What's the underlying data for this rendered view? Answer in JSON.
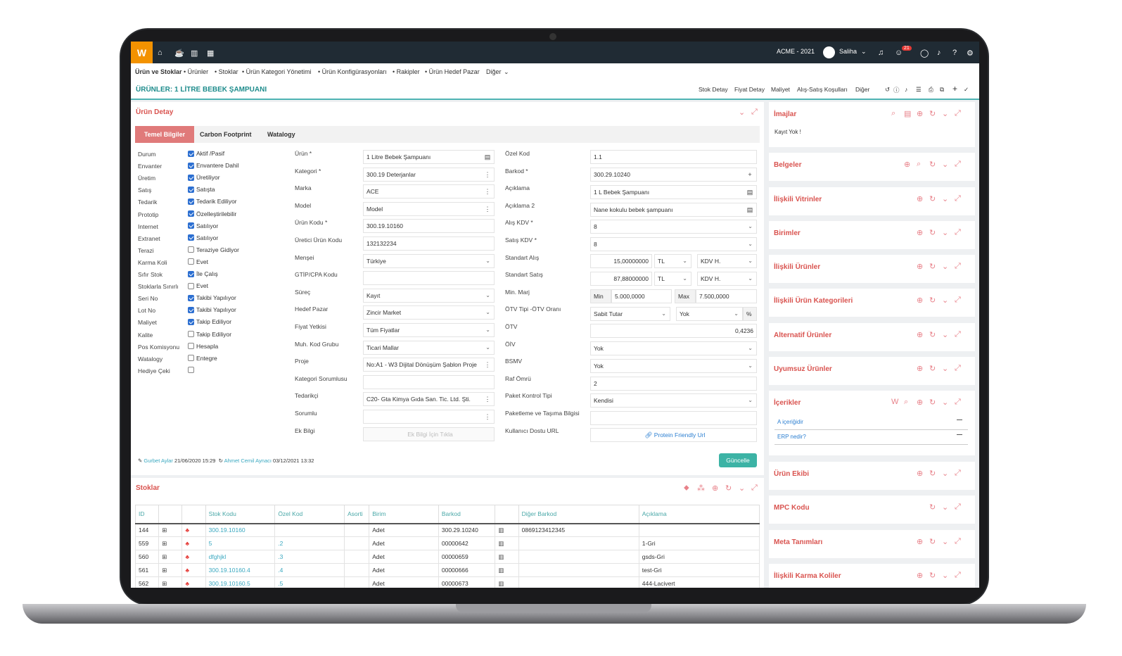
{
  "topbar": {
    "logo": "W",
    "company": "ACME - 2021",
    "user": "Saliha",
    "notif_count": "21"
  },
  "menu": [
    "Ürün ve Stoklar",
    "• Ürünler",
    "• Stoklar",
    "• Ürün Kategori Yönetimi",
    "• Ürün Konfigürasyonları",
    "• Rakipler",
    "• Ürün Hedef Pazar",
    "Diğer"
  ],
  "title": "ÜRÜNLER: 1 LİTRE BEBEK ŞAMPUANI",
  "title_links": [
    "Stok Detay",
    "Fiyat Detay",
    "Maliyet",
    "Alış-Satış Koşulları",
    "Diğer"
  ],
  "detail": {
    "heading": "Ürün Detay",
    "tabs": [
      "Temel Bilgiler",
      "Carbon Footprint",
      "Watalogy"
    ],
    "flags": [
      {
        "label": "Durum",
        "text": "Aktif /Pasif",
        "checked": true
      },
      {
        "label": "Envanter",
        "text": "Envantere Dahil",
        "checked": true
      },
      {
        "label": "Üretim",
        "text": "Üretiliyor",
        "checked": true
      },
      {
        "label": "Satış",
        "text": "Satışta",
        "checked": true
      },
      {
        "label": "Tedarik",
        "text": "Tedarik Ediliyor",
        "checked": true
      },
      {
        "label": "Prototip",
        "text": "Özelleştirilebilir",
        "checked": true
      },
      {
        "label": "Internet",
        "text": "Satılıyor",
        "checked": true
      },
      {
        "label": "Extranet",
        "text": "Satılıyor",
        "checked": true
      },
      {
        "label": "Terazi",
        "text": "Teraziye Gidiyor",
        "checked": false
      },
      {
        "label": "Karma Koli",
        "text": "Evet",
        "checked": false
      },
      {
        "label": "Sıfır Stok",
        "text": "İle Çalış",
        "checked": true
      },
      {
        "label": "Stoklarla Sınırlı",
        "text": "Evet",
        "checked": false
      },
      {
        "label": "Seri No",
        "text": "Takibi Yapılıyor",
        "checked": true
      },
      {
        "label": "Lot No",
        "text": "Takibi Yapılıyor",
        "checked": true
      },
      {
        "label": "Maliyet",
        "text": "Takip Ediliyor",
        "checked": true
      },
      {
        "label": "Kalite",
        "text": "Takip Ediliyor",
        "checked": false
      },
      {
        "label": "Pos Komisyonu",
        "text": "Hesapla",
        "checked": false
      },
      {
        "label": "Watalogy",
        "text": "Entegre",
        "checked": false
      },
      {
        "label": "Hediye Çeki",
        "text": "",
        "checked": false
      }
    ],
    "mid": [
      {
        "label": "Ürün *",
        "value": "1 Litre Bebek Şampuanı",
        "sfx": "▤"
      },
      {
        "label": "Kategori *",
        "value": "300.19 Deterjanlar",
        "sfx": "⋮"
      },
      {
        "label": "Marka",
        "value": "ACE",
        "sfx": "⋮"
      },
      {
        "label": "Model",
        "value": "Model",
        "sfx": "⋮"
      },
      {
        "label": "Ürün Kodu *",
        "value": "300.19.10160",
        "sfx": ""
      },
      {
        "label": "Üretici Ürün Kodu",
        "value": "132132234",
        "sfx": ""
      },
      {
        "label": "Menşei",
        "value": "Türkiye",
        "sfx": "⌄"
      },
      {
        "label": "GTİP/CPA Kodu",
        "value": "",
        "sfx": ""
      },
      {
        "label": "Süreç",
        "value": "Kayıt",
        "sfx": "⌄"
      },
      {
        "label": "Hedef Pazar",
        "value": "Zincir Market",
        "sfx": "⌄"
      },
      {
        "label": "Fiyat Yetkisi",
        "value": "Tüm Fiyatlar",
        "sfx": "⌄"
      },
      {
        "label": "Muh. Kod Grubu",
        "value": "Ticari Mallar",
        "sfx": "⌄"
      },
      {
        "label": "Proje",
        "value": "No:A1 - W3 Dijital Dönüşüm Şablon Proje",
        "sfx": "⋮"
      },
      {
        "label": "Kategori Sorumlusu",
        "value": "",
        "sfx": ""
      },
      {
        "label": "Tedarikçi",
        "value": "C20- Gta Kimya Gıda San. Tic. Ltd. Şti.",
        "sfx": "⋮"
      },
      {
        "label": "Sorumlu",
        "value": "",
        "sfx": "⋮"
      },
      {
        "label": "Ek Bilgi",
        "value": "Ek Bilgi İçin Tıkla",
        "sfx": ""
      }
    ],
    "right_labels": [
      "Özel Kod",
      "Barkod *",
      "Açıklama",
      "Açıklama 2",
      "Alış KDV *",
      "Satış KDV *",
      "Standart Alış",
      "Standart Satış",
      "Min. Marj",
      "ÖTV Tipi -ÖTV Oranı",
      "ÖTV",
      "ÖİV",
      "BSMV",
      "Raf Ömrü",
      "Paket Kontrol Tipi",
      "Paketleme ve Taşıma Bilgisi",
      "Kullanıcı Dostu URL"
    ],
    "right_values": {
      "ozel_kod": "1.1",
      "barkod": "300.29.10240",
      "aciklama": "1 L Bebek Şampuanı",
      "aciklama2": "Nane kokulu bebek şampuanı",
      "alis_kdv": "8",
      "satis_kdv": "8",
      "std_alis": "15,00000000",
      "std_alis_cur": "TL",
      "std_alis_kdv": "KDV H.",
      "std_satis": "87,88000000",
      "std_satis_cur": "TL",
      "std_satis_kdv": "KDV H.",
      "min_label": "Min",
      "min_val": "5.000,0000",
      "max_label": "Max",
      "max_val": "7.500,0000",
      "otv_tip": "Sabit Tutar",
      "otv_oran": "Yok",
      "otv_pct": "%",
      "otv": "0,4236",
      "oiv": "Yok",
      "bsmv": "Yok",
      "raf": "2",
      "paket": "Kendisi",
      "url": "Protein Friendly Url"
    },
    "footer": {
      "creator": "Gurbet Aylar",
      "created": "21/06/2020 15:29",
      "updater": "Ahmet Cemil Aynacı",
      "updated": "03/12/2021 13:32",
      "button": "Güncelle"
    }
  },
  "stocks": {
    "heading": "Stoklar",
    "columns": [
      "ID",
      "",
      "",
      "Stok Kodu",
      "Özel Kod",
      "Asorti",
      "Birim",
      "Barkod",
      "",
      "Diğer Barkod",
      "Açıklama"
    ],
    "rows": [
      {
        "id": "144",
        "code": "300.19.10160",
        "ozel": "",
        "unit": "Adet",
        "barkod": "300.29.10240",
        "diger": "0869123412345",
        "acik": ""
      },
      {
        "id": "559",
        "code": "5",
        "ozel": ".2",
        "unit": "Adet",
        "barkod": "00000642",
        "diger": "",
        "acik": "1-Gri"
      },
      {
        "id": "560",
        "code": "dfghjkl",
        "ozel": ".3",
        "unit": "Adet",
        "barkod": "00000659",
        "diger": "",
        "acik": "gsds-Gri"
      },
      {
        "id": "561",
        "code": "300.19.10160.4",
        "ozel": ".4",
        "unit": "Adet",
        "barkod": "00000666",
        "diger": "",
        "acik": "test-Gri"
      },
      {
        "id": "562",
        "code": "300.19.10160.5",
        "ozel": ".5",
        "unit": "Adet",
        "barkod": "00000673",
        "diger": "",
        "acik": "444-Lacivert"
      }
    ]
  },
  "side": [
    {
      "title": "İmajlar",
      "body": "Kayıt Yok !"
    },
    {
      "title": "Belgeler"
    },
    {
      "title": "İlişkili Vitrinler"
    },
    {
      "title": "Birimler"
    },
    {
      "title": "İlişkili Ürünler"
    },
    {
      "title": "İlişkili Ürün Kategorileri"
    },
    {
      "title": "Alternatif Ürünler"
    },
    {
      "title": "Uyumsuz Ürünler"
    },
    {
      "title": "İçerikler",
      "items": [
        "A içeriğidir",
        "ERP nedir?"
      ]
    },
    {
      "title": "Ürün Ekibi"
    },
    {
      "title": "MPC Kodu"
    },
    {
      "title": "Meta Tanımları"
    },
    {
      "title": "İlişkili Karma Koliler"
    }
  ]
}
